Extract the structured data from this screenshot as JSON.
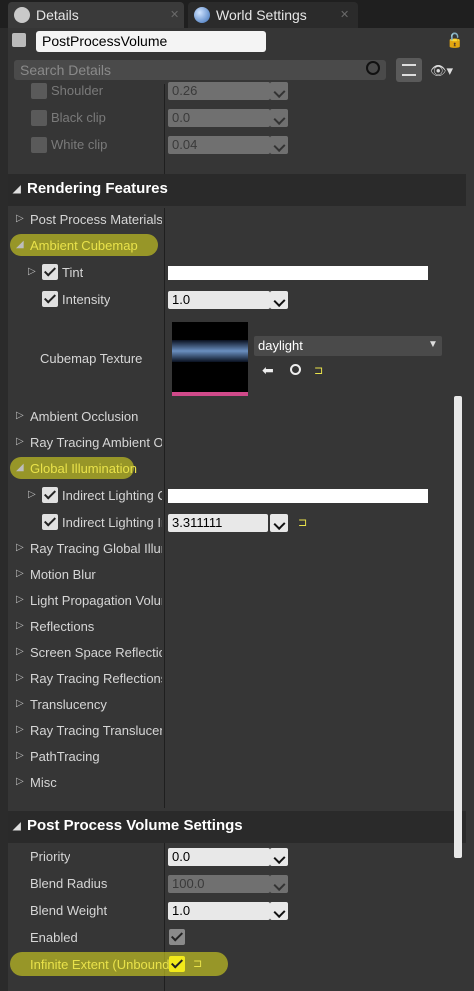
{
  "tabs": [
    {
      "label": "Details",
      "icon": "search-icon"
    },
    {
      "label": "World Settings",
      "icon": "globe-icon"
    }
  ],
  "header": {
    "object_name": "PostProcessVolume",
    "search_placeholder": "Search Details"
  },
  "tone_rows": [
    {
      "label": "Shoulder",
      "value": "0.26"
    },
    {
      "label": "Black clip",
      "value": "0.0"
    },
    {
      "label": "White clip",
      "value": "0.04"
    }
  ],
  "sections": {
    "rendering": "Rendering Features",
    "ppv": "Post Process Volume Settings"
  },
  "rendering": {
    "post_process_materials": "Post Process Materials",
    "ambient_cubemap": "Ambient Cubemap",
    "tint": "Tint",
    "intensity": "Intensity",
    "intensity_value": "1.0",
    "cubemap_texture": "Cubemap Texture",
    "cubemap_asset": "daylight",
    "ambient_occlusion": "Ambient Occlusion",
    "rt_ambient_occlusion": "Ray Tracing Ambient Oc",
    "global_illumination": "Global Illumination",
    "indirect_lighting_color": "Indirect Lighting C",
    "indirect_lighting_intensity": "Indirect Lighting In",
    "indirect_lighting_intensity_value": "3.311111",
    "others": [
      "Ray Tracing Global Illun",
      "Motion Blur",
      "Light Propagation Volur",
      "Reflections",
      "Screen Space Reflection",
      "Ray Tracing Reflections",
      "Translucency",
      "Ray Tracing Translucen",
      "PathTracing",
      "Misc"
    ]
  },
  "ppv": {
    "priority": "Priority",
    "priority_value": "0.0",
    "blend_radius": "Blend Radius",
    "blend_radius_value": "100.0",
    "blend_weight": "Blend Weight",
    "blend_weight_value": "1.0",
    "enabled": "Enabled",
    "infinite_extent": "Infinite Extent (Unbound)"
  },
  "colors": {
    "highlight": "#e9e24a",
    "panel": "#363636",
    "section_header": "#2a2a2a"
  }
}
